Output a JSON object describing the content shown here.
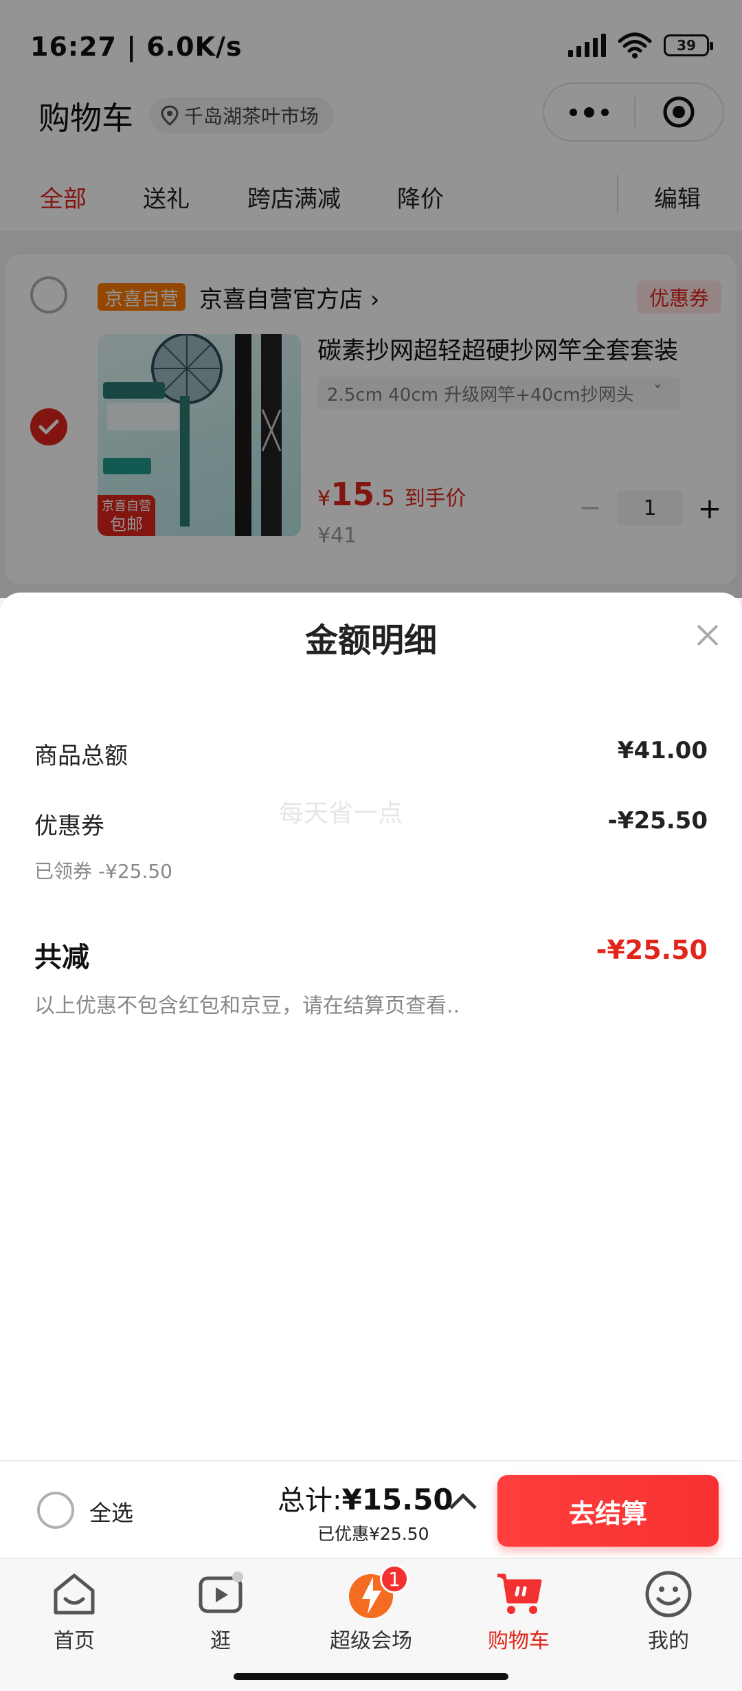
{
  "status": {
    "time": "16:27 | 6.0K/s",
    "battery": "39"
  },
  "nav": {
    "title": "购物车",
    "location": "千岛湖茶叶市场"
  },
  "tabs": [
    {
      "label": "全部"
    },
    {
      "label": "送礼"
    },
    {
      "label": "跨店满减"
    },
    {
      "label": "降价"
    }
  ],
  "edit_label": "编辑",
  "shop": {
    "tag": "京喜自营",
    "name": "京喜自营官方店",
    "coupon": "优惠券"
  },
  "product": {
    "title": "碳素抄网超轻超硬抄网竿全套套装",
    "spec": "2.5cm 40cm 升级网竿+40cm抄网头",
    "currency": "¥",
    "price_int": "15",
    "price_dec": ".5",
    "price_note": "到手价",
    "original_price": "¥41",
    "quantity": "1",
    "thumb_label_1": "京喜自营",
    "thumb_label_2": "包邮"
  },
  "sheet": {
    "title": "金额明细",
    "rows": [
      {
        "label": "商品总额",
        "value": "¥41.00"
      },
      {
        "label": "优惠券",
        "value": "-¥25.50"
      }
    ],
    "coupon_note": "已领券 -¥25.50",
    "watermark": "每天省一点",
    "total_label": "共减",
    "total_value": "-¥25.50",
    "disclaimer": "以上优惠不包含红包和京豆，请在结算页查看.."
  },
  "checkout": {
    "select_all": "全选",
    "total_prefix": "总计:",
    "total_amount": "¥15.50",
    "saved": "已优惠¥25.50",
    "pay": "去结算"
  },
  "tabbar": {
    "items": [
      {
        "label": "首页",
        "icon": "home-icon"
      },
      {
        "label": "逛",
        "icon": "video-play-icon"
      },
      {
        "label": "超级会场",
        "icon": "super-venue-icon",
        "badge": "1"
      },
      {
        "label": "购物车",
        "icon": "cart-icon",
        "active": true
      },
      {
        "label": "我的",
        "icon": "profile-face-icon"
      }
    ]
  },
  "colors": {
    "accent": "#e1251b",
    "pay_button": "#f73131",
    "shop_tag": "#ff7a00"
  }
}
